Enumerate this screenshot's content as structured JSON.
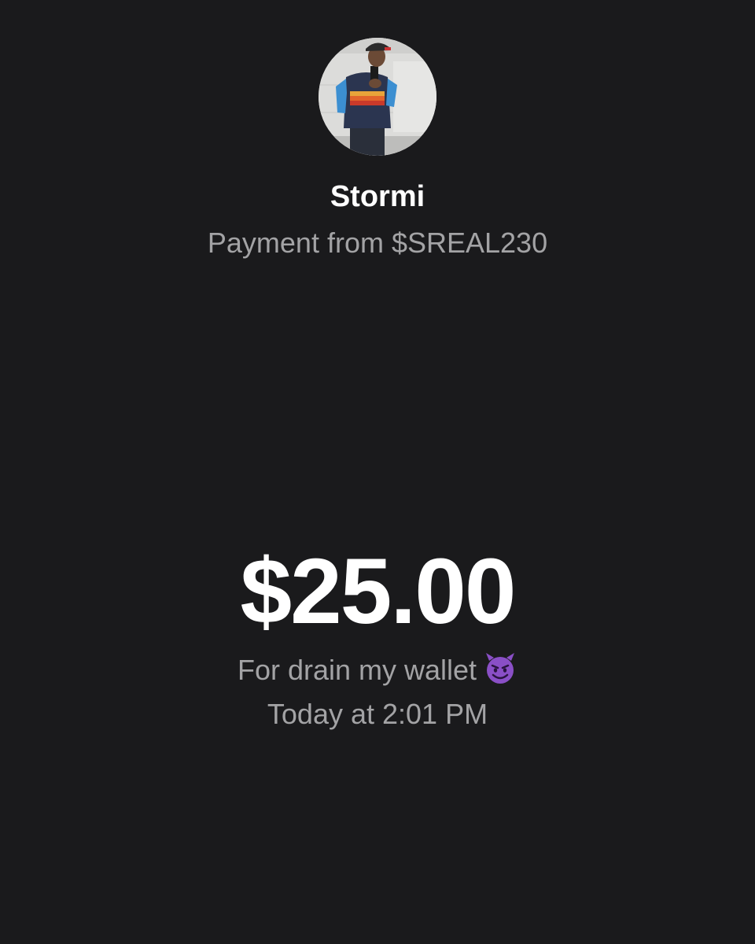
{
  "payment": {
    "sender_name": "Stormi",
    "subtitle": "Payment from $SREAL230",
    "amount": "$25.00",
    "note": "For drain my wallet",
    "note_emoji": "smiling-devil-icon",
    "timestamp": "Today at 2:01 PM"
  },
  "colors": {
    "background": "#1a1a1c",
    "primary_text": "#ffffff",
    "secondary_text": "#a3a3a5",
    "emoji_purple": "#8a4fc6"
  }
}
